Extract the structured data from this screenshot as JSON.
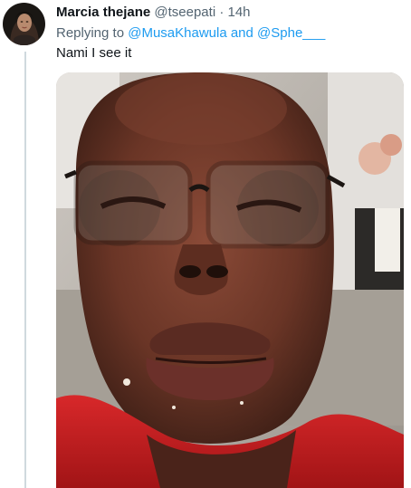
{
  "tweet": {
    "display_name": "Marcia thejane",
    "handle": "@tseepati",
    "separator": "·",
    "timestamp": "14h",
    "replying_prefix": "Replying to",
    "replying_mentions": "@MusaKhawula and @Sphe___",
    "text": "Nami I see it",
    "avatar_icon": "profile-photo",
    "media_icon": "video-frame"
  },
  "colors": {
    "name": "#0f1419",
    "secondary": "#536471",
    "mention": "#1d9bf0",
    "thread_line": "#cfd9de"
  }
}
